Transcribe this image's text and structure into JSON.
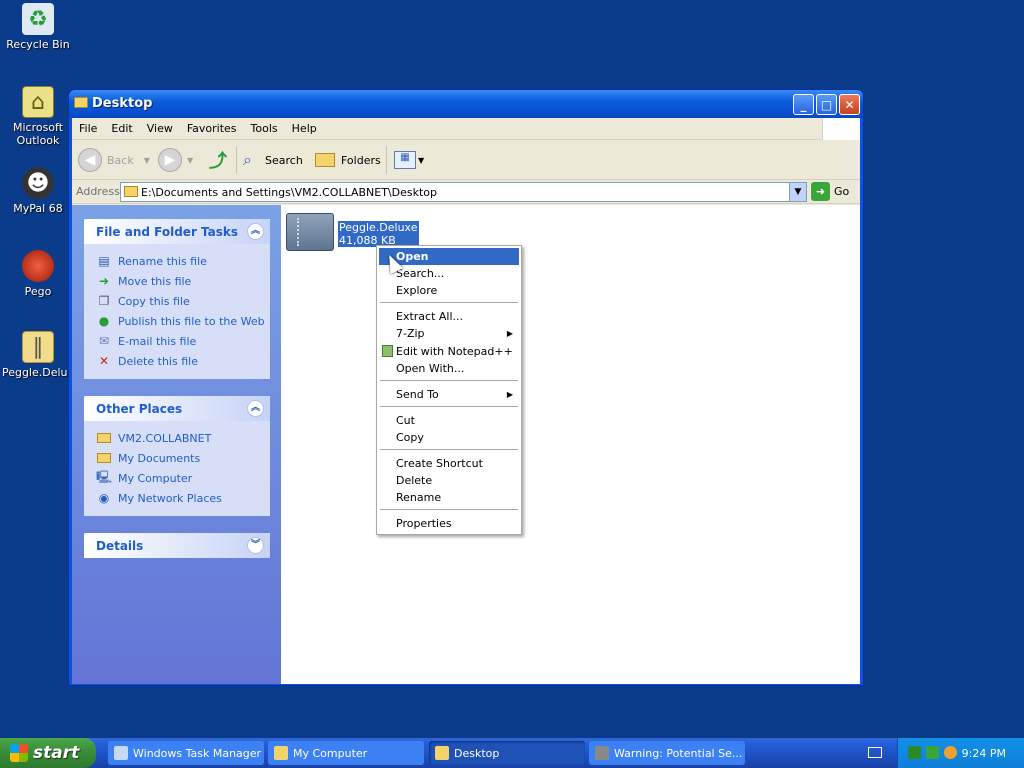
{
  "desktop": {
    "icons": [
      {
        "label": "Recycle Bin",
        "icon": "recycle-bin-icon"
      },
      {
        "label": "Microsoft Outlook",
        "icon": "outlook-icon"
      },
      {
        "label": "MyPal 68",
        "icon": "mypal-icon"
      },
      {
        "label": "Pego",
        "icon": "pego-icon"
      },
      {
        "label": "Peggle.Delux",
        "icon": "zip-folder-icon"
      }
    ]
  },
  "window": {
    "title": "Desktop",
    "menu": [
      "File",
      "Edit",
      "View",
      "Favorites",
      "Tools",
      "Help"
    ],
    "toolbar": {
      "back": "Back",
      "search": "Search",
      "folders": "Folders"
    },
    "address": {
      "label": "Address",
      "value": "E:\\Documents and Settings\\VM2.COLLABNET\\Desktop",
      "go": "Go"
    }
  },
  "tasks": {
    "file_folder": {
      "title": "File and Folder Tasks",
      "items": [
        "Rename this file",
        "Move this file",
        "Copy this file",
        "Publish this file to the Web",
        "E-mail this file",
        "Delete this file"
      ]
    },
    "other_places": {
      "title": "Other Places",
      "items": [
        "VM2.COLLABNET",
        "My Documents",
        "My Computer",
        "My Network Places"
      ]
    },
    "details": {
      "title": "Details"
    }
  },
  "file": {
    "name": "Peggle.Deluxe",
    "size": "41,088 KB"
  },
  "context_menu": {
    "items": [
      "Open",
      "Search...",
      "Explore",
      "Extract All...",
      "7-Zip",
      "Edit with Notepad++",
      "Open With...",
      "Send To",
      "Cut",
      "Copy",
      "Create Shortcut",
      "Delete",
      "Rename",
      "Properties"
    ]
  },
  "taskbar": {
    "start": "start",
    "items": [
      "Windows Task Manager",
      "My Computer",
      "Desktop",
      "Warning: Potential Se..."
    ],
    "clock": "9:24 PM"
  }
}
